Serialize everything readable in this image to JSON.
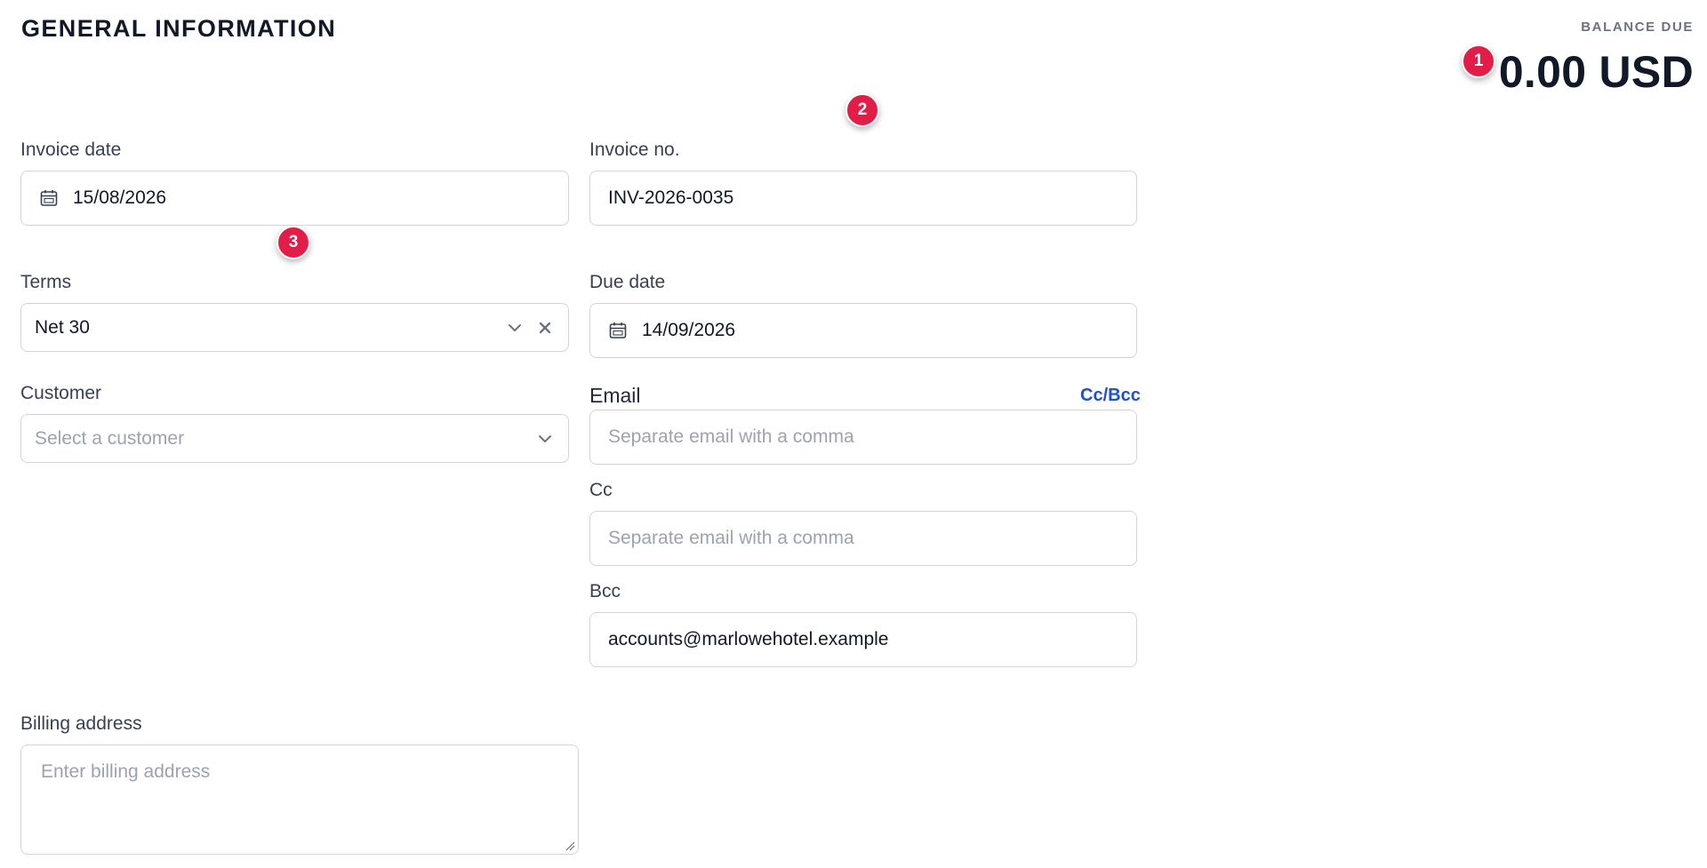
{
  "header": {
    "title": "GENERAL INFORMATION",
    "balance_label": "BALANCE DUE",
    "balance_value": "0.00 USD"
  },
  "markers": [
    "1",
    "2",
    "3"
  ],
  "form": {
    "invoice_date": {
      "label": "Invoice date",
      "value": "15/08/2026"
    },
    "invoice_no": {
      "label": "Invoice no.",
      "value": "INV-2026-0035"
    },
    "terms": {
      "label": "Terms",
      "value": "Net 30"
    },
    "due_date": {
      "label": "Due date",
      "value": "14/09/2026"
    },
    "customer": {
      "label": "Customer",
      "placeholder": "Select a customer"
    },
    "email": {
      "label": "Email",
      "cc_bcc_link": "Cc/Bcc",
      "placeholder": "Separate email with a comma"
    },
    "cc": {
      "label": "Cc",
      "placeholder": "Separate email with a comma"
    },
    "bcc": {
      "label": "Bcc",
      "value": "accounts@marlowehotel.example"
    },
    "billing_address": {
      "label": "Billing address",
      "placeholder": "Enter billing address"
    }
  },
  "icons": {
    "calendar": "calendar-icon",
    "chevron": "chevron-down-icon",
    "clear": "close-icon"
  },
  "colors": {
    "accent_link": "#1d4ed8",
    "marker": "#e11d48",
    "border": "#d1d5db",
    "placeholder": "#9ca3af"
  }
}
